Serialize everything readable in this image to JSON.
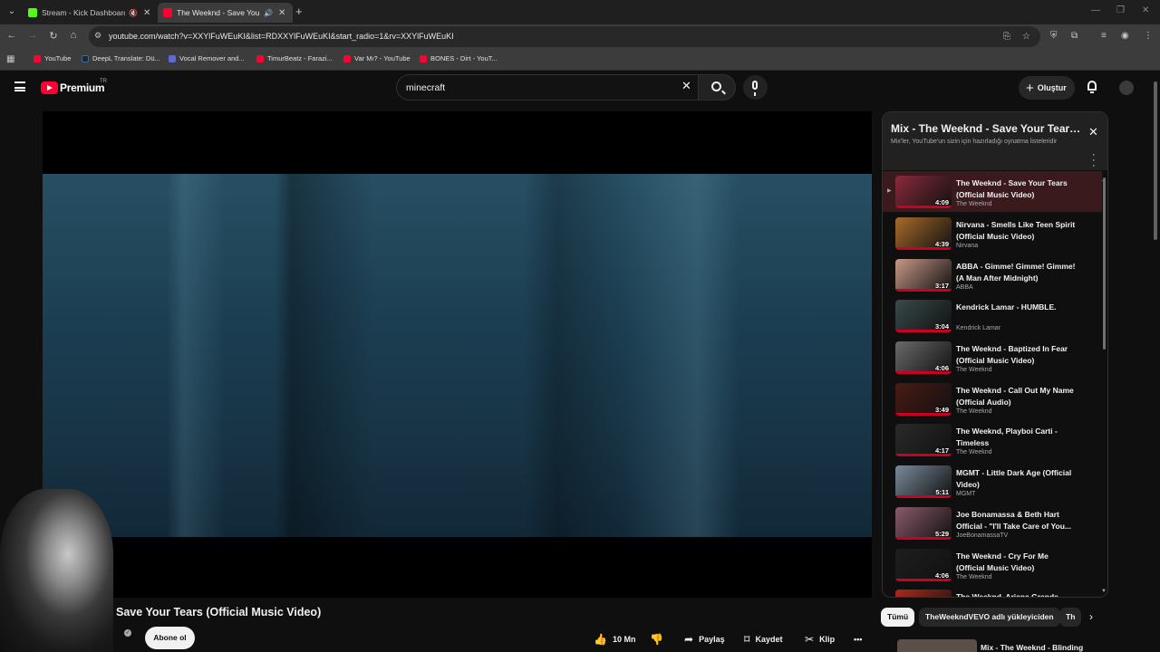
{
  "browser": {
    "tabs": [
      {
        "title": "Stream - Kick Dashboard",
        "color": "#53fc18"
      },
      {
        "title": "The Weeknd - Save Your Tears",
        "color": "#ff0033"
      }
    ],
    "url": "youtube.com/watch?v=XXYlFuWEuKI&list=RDXXYlFuWEuKI&start_radio=1&rv=XXYlFuWEuKI",
    "bookmarks": [
      {
        "label": "YouTube",
        "color": "#ff0033"
      },
      {
        "label": "DeepL Translate: Dü...",
        "color": "#0f2b46"
      },
      {
        "label": "Vocal Remover and...",
        "color": "#5b6bd8"
      },
      {
        "label": "TimurBeatz - Farazi...",
        "color": "#ff0033"
      },
      {
        "label": "Var Mı? - YouTube",
        "color": "#ff0033"
      },
      {
        "label": "BONES - Dirt - YouT...",
        "color": "#ff0033"
      }
    ]
  },
  "masthead": {
    "brand": "Premium",
    "region": "TR",
    "search_query": "minecraft",
    "create_label": "Oluştur"
  },
  "video": {
    "title": "Save Your Tears (Official Music Video)",
    "subscribe_label": "Abone ol",
    "likes": "10 Mn",
    "share_label": "Paylaş",
    "save_label": "Kaydet",
    "clip_label": "Klip"
  },
  "playlist": {
    "title": "Mix - The Weeknd - Save Your Tears (Official Music Video)",
    "subtitle": "Mix'ler, YouTube'un sizin için hazırladığı oynatma listeleridir",
    "items": [
      {
        "title": "The Weeknd - Save Your Tears (Official Music Video)",
        "channel": "The Weeknd",
        "duration": "4:09",
        "thumb": "#8a2a3a"
      },
      {
        "title": "Nirvana - Smells Like Teen Spirit (Official Music Video)",
        "channel": "Nirvana",
        "duration": "4:39",
        "thumb": "#a86a2a"
      },
      {
        "title": "ABBA - Gimme! Gimme! Gimme! (A Man After Midnight)",
        "channel": "ABBA",
        "duration": "3:17",
        "thumb": "#c89888"
      },
      {
        "title": "Kendrick Lamar - HUMBLE.",
        "channel": "Kendrick Lamar",
        "duration": "3:04",
        "thumb": "#3a4a4a"
      },
      {
        "title": "The Weeknd - Baptized In Fear (Official Music Video)",
        "channel": "The Weeknd",
        "duration": "4:06",
        "thumb": "#6a6a6a"
      },
      {
        "title": "The Weeknd - Call Out My Name (Official Audio)",
        "channel": "The Weeknd",
        "duration": "3:49",
        "thumb": "#4a1a14"
      },
      {
        "title": "The Weeknd, Playboi Carti - Timeless",
        "channel": "The Weeknd",
        "duration": "4:17",
        "thumb": "#2a2a2a"
      },
      {
        "title": "MGMT - Little Dark Age (Official Video)",
        "channel": "MGMT",
        "duration": "5:11",
        "thumb": "#7a8a9a"
      },
      {
        "title": "Joe Bonamassa & Beth Hart Official - \"I'll Take Care of You...",
        "channel": "JoeBonamassaTV",
        "duration": "5:29",
        "thumb": "#8a5a6a"
      },
      {
        "title": "The Weeknd - Cry For Me (Official Music Video)",
        "channel": "The Weeknd",
        "duration": "4:06",
        "thumb": "#1e1e1e"
      },
      {
        "title": "The Weeknd, Ariana Grande -",
        "channel": "",
        "duration": "",
        "thumb": "#aa2a1a"
      }
    ]
  },
  "chips": [
    "Tümü",
    "TheWeekndVEVO adlı yükleyiciden",
    "Th"
  ],
  "next_up": {
    "title": "Mix - The Weeknd - Blinding"
  }
}
